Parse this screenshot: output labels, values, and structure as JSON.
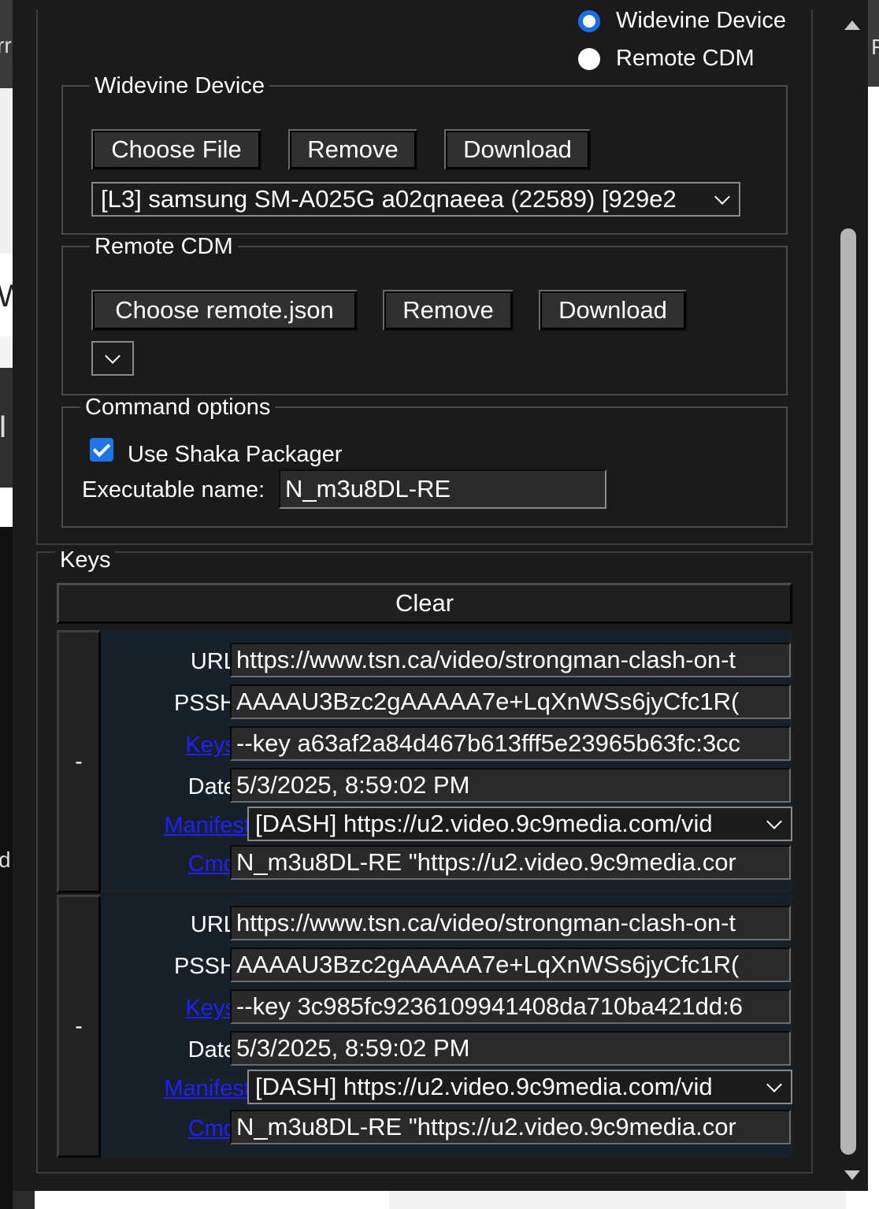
{
  "background": {
    "left_fragments": [
      "rr",
      "W",
      "I",
      "d"
    ],
    "right_fragment": "F"
  },
  "device_type": {
    "options": [
      {
        "label": "Widevine Device",
        "selected": true
      },
      {
        "label": "Remote CDM",
        "selected": false
      }
    ]
  },
  "widevine_device": {
    "legend": "Widevine Device",
    "choose_file_label": "Choose File",
    "remove_label": "Remove",
    "download_label": "Download",
    "selected_device": "[L3] samsung SM-A025G a02qnaeea (22589) [929e2"
  },
  "remote_cdm": {
    "legend": "Remote CDM",
    "choose_label": "Choose remote.json",
    "remove_label": "Remove",
    "download_label": "Download",
    "selected_value": ""
  },
  "command_options": {
    "legend": "Command options",
    "use_shaka_label": "Use Shaka Packager",
    "use_shaka_checked": true,
    "exec_name_label": "Executable name:",
    "exec_name_value": "N_m3u8DL-RE"
  },
  "keys": {
    "legend": "Keys",
    "clear_label": "Clear",
    "remove_entry_label": "-",
    "labels": {
      "url": "URL:",
      "pssh": "PSSH:",
      "keys": "Keys:",
      "date": "Date:",
      "manifest": "Manifest:",
      "cmd": "Cmd:"
    },
    "entries": [
      {
        "url": "https://www.tsn.ca/video/strongman-clash-on-t",
        "pssh": "AAAAU3Bzc2gAAAAA7e+LqXnWSs6jyCfc1R(",
        "keys": "--key a63af2a84d467b613fff5e23965b63fc:3cc",
        "date": "5/3/2025, 8:59:02 PM",
        "manifest": "[DASH] https://u2.video.9c9media.com/vid",
        "cmd": "N_m3u8DL-RE \"https://u2.video.9c9media.cor"
      },
      {
        "url": "https://www.tsn.ca/video/strongman-clash-on-t",
        "pssh": "AAAAU3Bzc2gAAAAA7e+LqXnWSs6jyCfc1R(",
        "keys": "--key 3c985fc9236109941408da710ba421dd:6",
        "date": "5/3/2025, 8:59:02 PM",
        "manifest": "[DASH] https://u2.video.9c9media.com/vid",
        "cmd": "N_m3u8DL-RE \"https://u2.video.9c9media.cor"
      }
    ]
  },
  "colors": {
    "panel_bg": "#1b1b1b",
    "entry_bg": "#18202a",
    "link": "#1f1fff",
    "accent": "#1f74e8"
  }
}
